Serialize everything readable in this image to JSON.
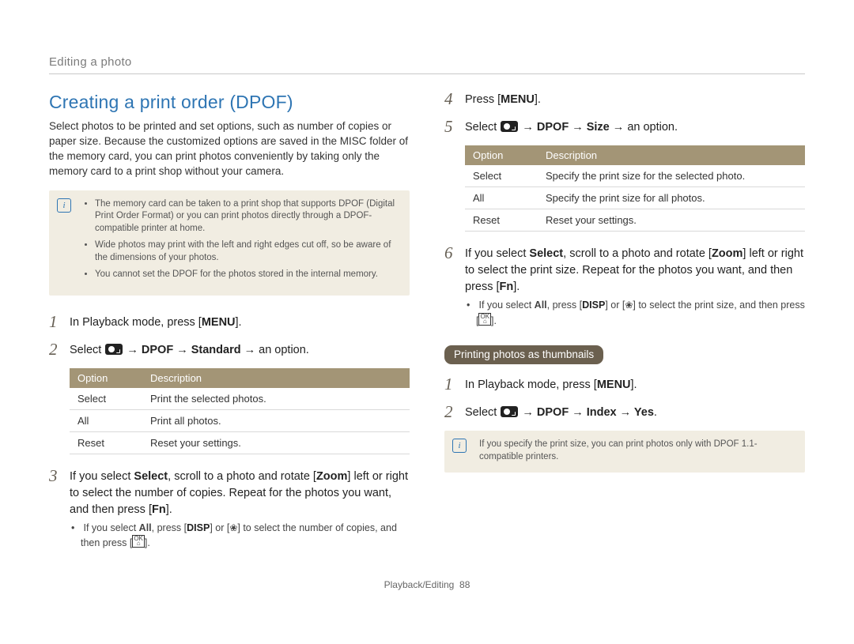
{
  "breadcrumb": "Editing a photo",
  "section_title": "Creating a print order (DPOF)",
  "intro": "Select photos to be printed and set options, such as number of copies or paper size. Because the customized options are saved in the MISC folder of the memory card, you can print photos conveniently by taking only the memory card to a print shop without your camera.",
  "note1": {
    "items": [
      "The memory card can be taken to a print shop that supports DPOF (Digital Print Order Format) or you can print photos directly through a DPOF-compatible printer at home.",
      "Wide photos may print with the left and right edges cut off, so be aware of the dimensions of your photos.",
      "You cannot set the DPOF for the photos stored in the internal memory."
    ]
  },
  "left_steps": {
    "s1_pre": "In Playback mode, press [",
    "s1_cap": "MENU",
    "s1_post": "].",
    "s2_pre": "Select ",
    "s2_path": " → DPOF → Standard → ",
    "s2_tail": "an option.",
    "s3_a": "If you select ",
    "s3_b": "Select",
    "s3_c": ", scroll to a photo and rotate [",
    "s3_d": "Zoom",
    "s3_e": "] left or right to select the number of copies. Repeat for the photos you want, and then press [",
    "s3_f": "Fn",
    "s3_g": "].",
    "s3_sub_a": "If you select ",
    "s3_sub_b": "All",
    "s3_sub_c": ", press [",
    "s3_sub_disp": "DISP",
    "s3_sub_d": "] or [",
    "s3_sub_e": "] to select the number of copies, and then press [",
    "s3_sub_f": "]."
  },
  "table1": {
    "h1": "Option",
    "h2": "Description",
    "rows": [
      {
        "opt": "Select",
        "desc": "Print the selected photos."
      },
      {
        "opt": "All",
        "desc": "Print all photos."
      },
      {
        "opt": "Reset",
        "desc": "Reset your settings."
      }
    ]
  },
  "right_steps": {
    "s4_pre": "Press [",
    "s4_cap": "MENU",
    "s4_post": "].",
    "s5_pre": "Select ",
    "s5_path": " → DPOF → Size → ",
    "s5_tail": "an option.",
    "s6_a": "If you select ",
    "s6_b": "Select",
    "s6_c": ", scroll to a photo and rotate [",
    "s6_d": "Zoom",
    "s6_e": "] left or right to select the print size. Repeat for the photos you want, and then press [",
    "s6_f": "Fn",
    "s6_g": "].",
    "s6_sub_a": "If you select ",
    "s6_sub_b": "All",
    "s6_sub_c": ", press [",
    "s6_sub_disp": "DISP",
    "s6_sub_d": "] or [",
    "s6_sub_e": "] to select the print size, and then press [",
    "s6_sub_f": "]."
  },
  "table2": {
    "h1": "Option",
    "h2": "Description",
    "rows": [
      {
        "opt": "Select",
        "desc": "Specify the print size for the selected photo."
      },
      {
        "opt": "All",
        "desc": "Specify the print size for all photos."
      },
      {
        "opt": "Reset",
        "desc": "Reset your settings."
      }
    ]
  },
  "thumbnails": {
    "badge": "Printing photos as thumbnails",
    "s1_pre": "In Playback mode, press [",
    "s1_cap": "MENU",
    "s1_post": "].",
    "s2_pre": "Select ",
    "s2_path": " → DPOF → Index → Yes",
    "s2_tail": "."
  },
  "note2": "If you specify the print size, you can print photos only with DPOF 1.1-compatible printers.",
  "footer": {
    "section": "Playback/Editing",
    "page": "88"
  }
}
